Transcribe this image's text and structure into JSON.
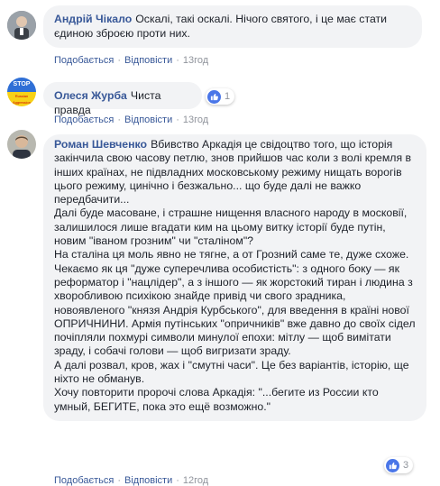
{
  "comments": [
    {
      "author": "Андрій Чікало",
      "text": "Оскалі, такі оскалі. Нічого святого, і це має стати єдиною зброєю проти них.",
      "like_label": "Подобається",
      "reply_label": "Відповісти",
      "time": "13год"
    },
    {
      "author": "Олеся Журба",
      "avatar_text": [
        "STOP",
        "Russian",
        "Aggression"
      ],
      "text": "Чиста правда",
      "like_label": "Подобається",
      "reply_label": "Відповісти",
      "time": "13год",
      "reaction_count": "1"
    },
    {
      "author": "Роман Шевченко",
      "paragraphs": [
        "Вбивство Аркадія це свідоцтво того, що історія закінчила свою часову петлю, знов прийшов час коли з волі кремля в інших країнах, не підвладних московському режиму нищать ворогів цього режиму, цинічно і безжально... що буде далі не важко передбачити...",
        "Далі буде масоване, і страшне нищення власного народу в московії, залишилося лише вгадати ким на цьому витку історії буде путін, новим \"іваном грозним\" чи \"сталіном\"?",
        "На сталіна ця моль явно не тягне, а от Грозний саме те, дуже схоже.",
        "Чекаємо як ця \"дуже суперечлива особистість\": з одного боку — як реформатор і \"нацлідер\", а з іншого — як жорстокий тиран і людина з хворобливою психікою знайде привід чи свого зрадника, новоявленого \"князя Андрія Курбського\", для введення в країні нової ОПРИЧНИНИ. Армія путінських \"опричників\" вже давно до своїх сідел почіпляли похмурі символи минулої епохи: мітлу — щоб вимітати зраду, і собачі голови — щоб вигризати зраду.",
        "А далі розвал, кров, жах і \"смутні часи\". Це без варіантів, історію, ще ніхто не обманув.",
        "Хочу повторити пророчі слова Аркадія: \"...бегите из России кто умный, БЕГИТЕ, пока это ещё возможно.\""
      ],
      "like_label": "Подобається",
      "reply_label": "Відповісти",
      "time": "12год",
      "reaction_count": "3"
    }
  ],
  "colors": {
    "link": "#385898",
    "bubble": "#f2f3f5",
    "like": "#4a76e8",
    "muted": "#90949c"
  }
}
